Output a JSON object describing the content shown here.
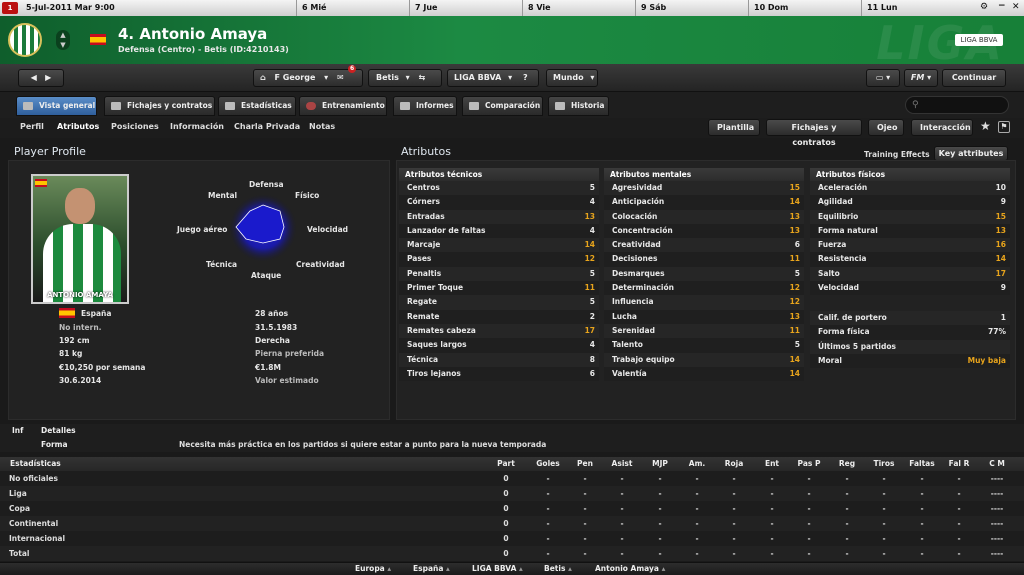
{
  "datebar": {
    "current_date": "5-Jul-2011  Mar  9:00",
    "calendar_icon_text": "1",
    "days": [
      "6 Mié",
      "7 Jue",
      "8 Vie",
      "9 Sáb",
      "10 Dom",
      "11 Lun"
    ]
  },
  "header": {
    "title": "4. Antonio Amaya",
    "subtitle": "Defensa (Centro) - Betis (ID:4210143)",
    "bg_text": "LIGA",
    "league_logo": "LIGA BBVA"
  },
  "toolbar": {
    "manager": "F George",
    "inbox_badge": "6",
    "club": "Betis",
    "league": "LIGA BBVA",
    "world": "Mundo",
    "fm": "FM",
    "continue": "Continuar"
  },
  "tabs": [
    {
      "label": "Vista general"
    },
    {
      "label": "Fichajes y contratos"
    },
    {
      "label": "Estadísticas"
    },
    {
      "label": "Entrenamiento"
    },
    {
      "label": "Informes"
    },
    {
      "label": "Comparación"
    },
    {
      "label": "Historia"
    }
  ],
  "subtabs": [
    "Perfil",
    "Atributos",
    "Posiciones",
    "Información",
    "Charla Privada",
    "Notas"
  ],
  "right_buttons": [
    "Plantilla",
    "Fichajes y contratos",
    "Ojeo",
    "Interacción"
  ],
  "profile": {
    "title": "Player Profile",
    "photo_caption": "ANTONIO AMAYA",
    "radar_labels": {
      "defensa": "Defensa",
      "mental": "Mental",
      "fisico": "Físico",
      "juego_aereo": "Juego aéreo",
      "velocidad": "Velocidad",
      "tecnica": "Técnica",
      "creatividad": "Creatividad",
      "ataque": "Ataque"
    },
    "nationality": "España",
    "international": "No intern.",
    "height": "192 cm",
    "weight": "81 kg",
    "wage": "€10,250 por semana",
    "contract_end": "30.6.2014",
    "age": "28 años",
    "dob": "31.5.1983",
    "foot": "Derecha",
    "foot_label": "Pierna preferida",
    "value": "€1.8M",
    "value_label": "Valor estimado"
  },
  "attributes": {
    "title": "Atributos",
    "training_effects": "Training Effects",
    "key_attributes": "Key attributes",
    "tecnicos": {
      "title": "Atributos técnicos",
      "rows": [
        {
          "n": "Centros",
          "v": "5"
        },
        {
          "n": "Córners",
          "v": "4"
        },
        {
          "n": "Entradas",
          "v": "13"
        },
        {
          "n": "Lanzador de faltas",
          "v": "4"
        },
        {
          "n": "Marcaje",
          "v": "14"
        },
        {
          "n": "Pases",
          "v": "12"
        },
        {
          "n": "Penaltis",
          "v": "5"
        },
        {
          "n": "Primer Toque",
          "v": "11"
        },
        {
          "n": "Regate",
          "v": "5"
        },
        {
          "n": "Remate",
          "v": "2"
        },
        {
          "n": "Remates cabeza",
          "v": "17"
        },
        {
          "n": "Saques largos",
          "v": "4"
        },
        {
          "n": "Técnica",
          "v": "8"
        },
        {
          "n": "Tiros lejanos",
          "v": "6"
        }
      ]
    },
    "mentales": {
      "title": "Atributos mentales",
      "rows": [
        {
          "n": "Agresividad",
          "v": "15"
        },
        {
          "n": "Anticipación",
          "v": "14"
        },
        {
          "n": "Colocación",
          "v": "13"
        },
        {
          "n": "Concentración",
          "v": "13"
        },
        {
          "n": "Creatividad",
          "v": "6"
        },
        {
          "n": "Decisiones",
          "v": "11"
        },
        {
          "n": "Desmarques",
          "v": "5"
        },
        {
          "n": "Determinación",
          "v": "12"
        },
        {
          "n": "Influencia",
          "v": "12"
        },
        {
          "n": "Lucha",
          "v": "13"
        },
        {
          "n": "Serenidad",
          "v": "11"
        },
        {
          "n": "Talento",
          "v": "5"
        },
        {
          "n": "Trabajo equipo",
          "v": "14"
        },
        {
          "n": "Valentía",
          "v": "14"
        }
      ]
    },
    "fisicos": {
      "title": "Atributos físicos",
      "rows": [
        {
          "n": "Aceleración",
          "v": "10"
        },
        {
          "n": "Agilidad",
          "v": "9"
        },
        {
          "n": "Equilibrio",
          "v": "15"
        },
        {
          "n": "Forma natural",
          "v": "13"
        },
        {
          "n": "Fuerza",
          "v": "16"
        },
        {
          "n": "Resistencia",
          "v": "14"
        },
        {
          "n": "Salto",
          "v": "17"
        },
        {
          "n": "Velocidad",
          "v": "9"
        }
      ],
      "extra": [
        {
          "n": "Calif. de portero",
          "v": "1"
        },
        {
          "n": "Forma física",
          "v": "77%"
        },
        {
          "n": "Últimos 5 partidos",
          "v": ""
        },
        {
          "n": "Moral",
          "v": "Muy baja"
        }
      ]
    }
  },
  "info": {
    "inf_label": "Inf",
    "details_label": "Detalles",
    "form_label": "Forma",
    "form_text": "Necesita más práctica en los partidos si quiere estar a punto para la nueva temporada"
  },
  "stats": {
    "title": "Estadísticas",
    "columns": [
      "Part",
      "Goles",
      "Pen",
      "Asist",
      "MJP",
      "Am.",
      "Roja",
      "Ent",
      "Pas P",
      "Reg",
      "Tiros",
      "Faltas",
      "Fal R",
      "C M"
    ],
    "rows": [
      {
        "label": "No oficiales",
        "cells": [
          "0",
          "-",
          "-",
          "-",
          "-",
          "-",
          "-",
          "-",
          "-",
          "-",
          "-",
          "-",
          "-",
          "----"
        ]
      },
      {
        "label": "Liga",
        "cells": [
          "0",
          "-",
          "-",
          "-",
          "-",
          "-",
          "-",
          "-",
          "-",
          "-",
          "-",
          "-",
          "-",
          "----"
        ]
      },
      {
        "label": "Copa",
        "cells": [
          "0",
          "-",
          "-",
          "-",
          "-",
          "-",
          "-",
          "-",
          "-",
          "-",
          "-",
          "-",
          "-",
          "----"
        ]
      },
      {
        "label": "Continental",
        "cells": [
          "0",
          "-",
          "-",
          "-",
          "-",
          "-",
          "-",
          "-",
          "-",
          "-",
          "-",
          "-",
          "-",
          "----"
        ]
      },
      {
        "label": "Internacional",
        "cells": [
          "0",
          "-",
          "-",
          "-",
          "-",
          "-",
          "-",
          "-",
          "-",
          "-",
          "-",
          "-",
          "-",
          "----"
        ]
      },
      {
        "label": "Total",
        "cells": [
          "0",
          "-",
          "-",
          "-",
          "-",
          "-",
          "-",
          "-",
          "-",
          "-",
          "-",
          "-",
          "-",
          "----"
        ]
      }
    ]
  },
  "breadcrumb": [
    "Europa",
    "España",
    "LIGA BBVA",
    "Betis",
    "Antonio Amaya"
  ],
  "colors": {
    "header_green": "#1c8a43",
    "tab_active_blue": "#3f73b3",
    "attr_orange": "#e8a41c"
  }
}
